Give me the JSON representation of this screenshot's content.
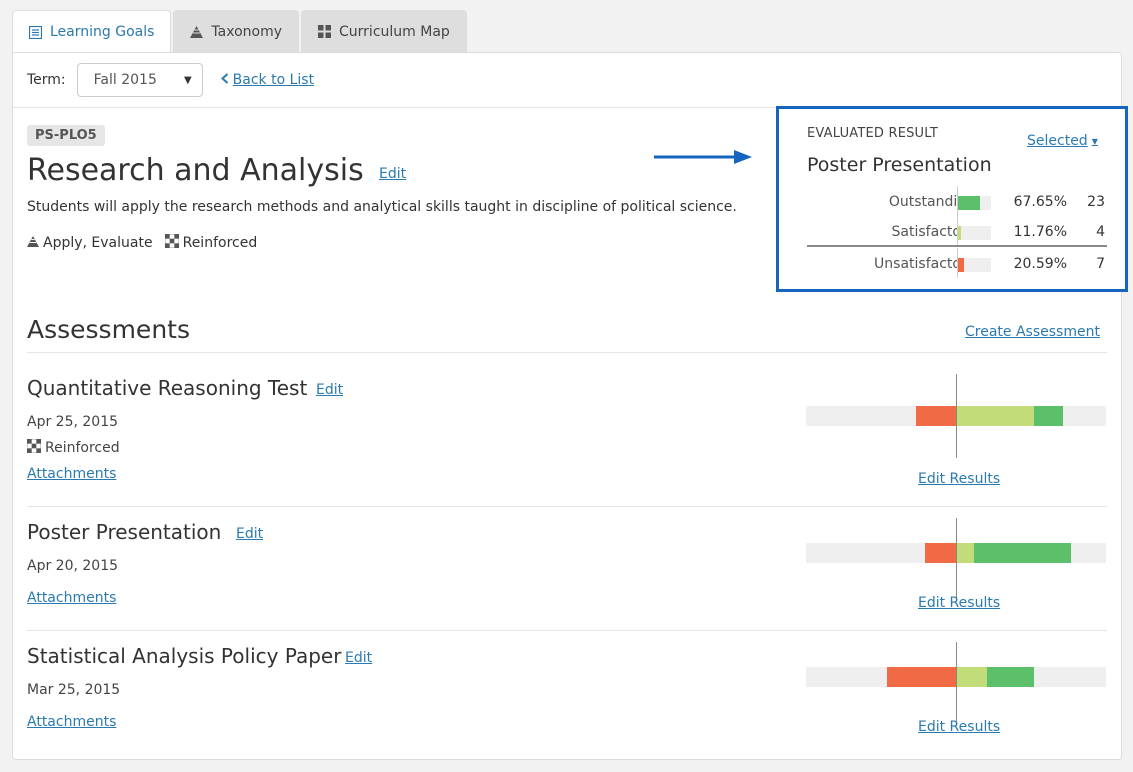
{
  "tabs": [
    {
      "label": "Learning Goals",
      "icon": "list-icon",
      "active": true
    },
    {
      "label": "Taxonomy",
      "icon": "pyramid-icon",
      "active": false
    },
    {
      "label": "Curriculum Map",
      "icon": "grid-icon",
      "active": false
    }
  ],
  "term": {
    "label": "Term:",
    "value": "Fall 2015"
  },
  "back_link": "Back to List",
  "goal": {
    "code": "PS-PLO5",
    "title": "Research and Analysis",
    "edit": "Edit",
    "description": "Students will apply the research methods and analytical skills taught in discipline of political science.",
    "taxonomy": "Apply, Evaluate",
    "level": "Reinforced"
  },
  "evaluated": {
    "label": "EVALUATED RESULT",
    "selector": "Selected",
    "title": "Poster Presentation",
    "rows": [
      {
        "label": "Outstanding",
        "percent": "67.65%",
        "count": "23",
        "fraction": 0.6765,
        "color": "#5cbf6a"
      },
      {
        "label": "Satisfactory",
        "percent": "11.76%",
        "count": "4",
        "fraction": 0.1176,
        "color": "#c3dc7a"
      },
      {
        "label": "Unsatisfactory",
        "percent": "20.59%",
        "count": "7",
        "fraction": 0.2059,
        "color": "#f06a45"
      }
    ]
  },
  "assessments_heading": "Assessments",
  "create_assessment": "Create Assessment",
  "assessments": [
    {
      "title": "Quantitative Reasoning Test",
      "edit": "Edit",
      "date": "Apr 25, 2015",
      "level": "Reinforced",
      "attachments": "Attachments",
      "edit_results": "Edit Results",
      "distribution": {
        "unsatisfactory": 0.2059,
        "satisfactory": 0.4,
        "outstanding": 0.15
      }
    },
    {
      "title": "Poster Presentation",
      "edit": "Edit",
      "date": "Apr 20, 2015",
      "attachments": "Attachments",
      "edit_results": "Edit Results",
      "distribution": {
        "unsatisfactory": 0.16,
        "satisfactory": 0.09,
        "outstanding": 0.5
      }
    },
    {
      "title": "Statistical Analysis Policy Paper",
      "edit": "Edit",
      "date": "Mar 25, 2015",
      "attachments": "Attachments",
      "edit_results": "Edit Results",
      "distribution": {
        "unsatisfactory": 0.355,
        "satisfactory": 0.16,
        "outstanding": 0.24
      }
    }
  ],
  "colors": {
    "outstanding": "#5cbf6a",
    "satisfactory": "#c3dc7a",
    "unsatisfactory": "#f06a45",
    "link": "#2a7ab0",
    "highlight": "#1565c0"
  }
}
